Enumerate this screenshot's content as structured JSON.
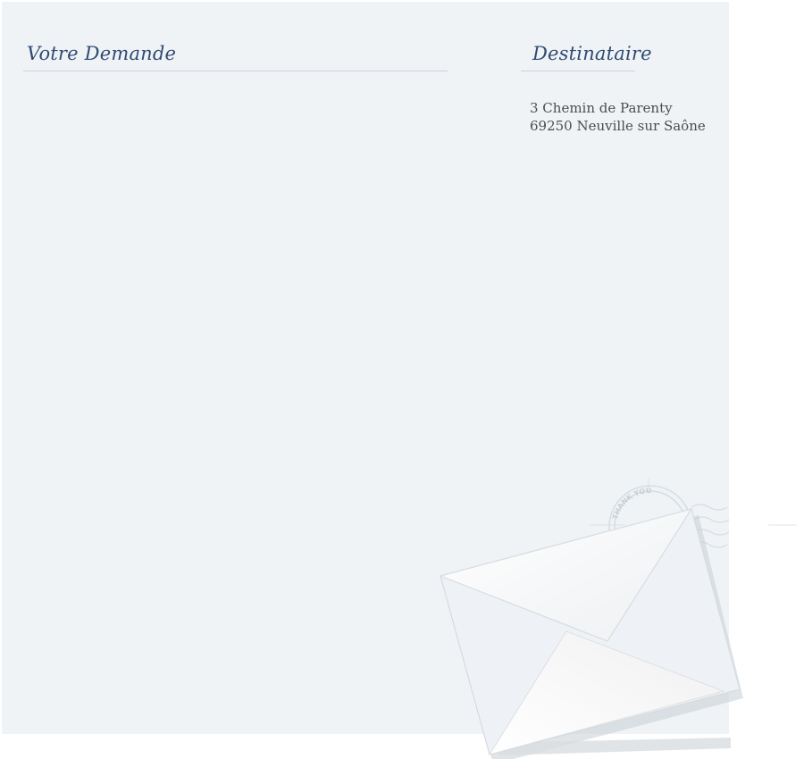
{
  "request_section": {
    "title": "Votre Demande"
  },
  "recipient_section": {
    "title": "Destinataire",
    "address_line_1": "3 Chemin de Parenty",
    "address_line_2": "69250 Neuville sur Saône"
  },
  "decoration": {
    "icon": "envelope-icon",
    "stamp_icon": "postmark-stamp-icon",
    "stamp_text": "THANK YOU"
  },
  "colors": {
    "panel_background": "#eff3f6",
    "heading": "#2f4a72",
    "address_text": "#4d4d4d",
    "rule": "#c9d2dc"
  }
}
